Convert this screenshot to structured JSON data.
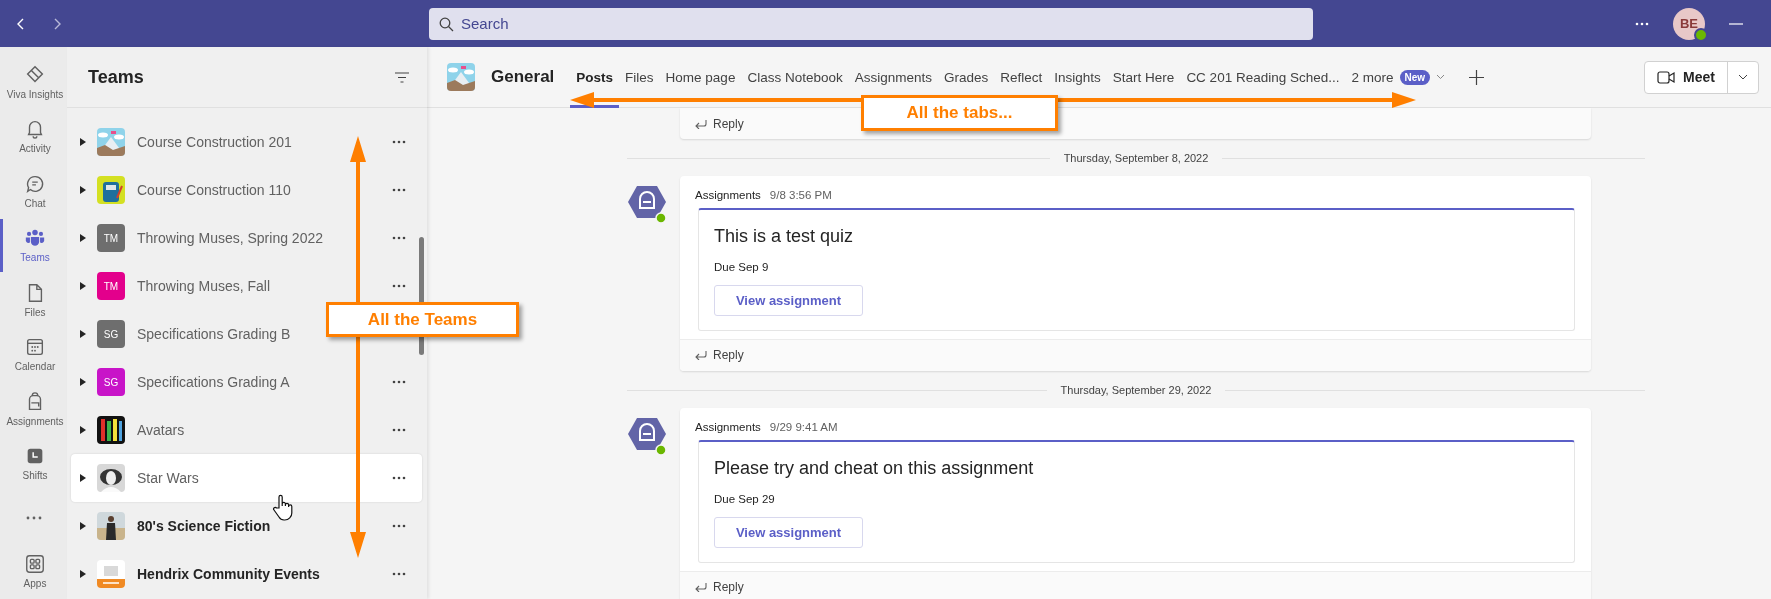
{
  "top_bar": {
    "search": {
      "placeholder": "Search"
    },
    "user": {
      "initials": "BE",
      "online": true
    }
  },
  "rail": [
    {
      "label": "Viva Insights",
      "selected": false
    },
    {
      "label": "Activity",
      "selected": false
    },
    {
      "label": "Chat",
      "selected": false
    },
    {
      "label": "Teams",
      "selected": true
    },
    {
      "label": "Files",
      "selected": false
    },
    {
      "label": "Calendar",
      "selected": false
    },
    {
      "label": "Assignments",
      "selected": false
    },
    {
      "label": "Shifts",
      "selected": false
    },
    {
      "label": "Apps",
      "selected": false
    }
  ],
  "teams_panel": {
    "title": "Teams",
    "teams": [
      {
        "name": "Course Construction 201",
        "unread": false,
        "highlighted": false
      },
      {
        "name": "Course Construction 110",
        "unread": false,
        "highlighted": false
      },
      {
        "name": "Throwing Muses, Spring 2022",
        "avatar": {
          "kind": "initials",
          "initials": "TM",
          "color": "#6e6e6e"
        },
        "unread": false,
        "highlighted": false
      },
      {
        "name": "Throwing Muses, Fall",
        "avatar": {
          "kind": "initials",
          "initials": "TM",
          "color": "#e3008c"
        },
        "unread": false,
        "highlighted": false
      },
      {
        "name": "Specifications Grading B",
        "avatar": {
          "kind": "initials",
          "initials": "SG",
          "color": "#6e6e6e"
        },
        "unread": false,
        "highlighted": false
      },
      {
        "name": "Specifications Grading A",
        "avatar": {
          "kind": "initials",
          "initials": "SG",
          "color": "#c814c8"
        },
        "unread": false,
        "highlighted": false
      },
      {
        "name": "Avatars",
        "unread": false,
        "highlighted": false
      },
      {
        "name": "Star Wars",
        "unread": false,
        "highlighted": true
      },
      {
        "name": "80's Science Fiction",
        "unread": true,
        "highlighted": false
      },
      {
        "name": "Hendrix Community Events",
        "unread": true,
        "highlighted": false
      }
    ]
  },
  "channel": {
    "name": "General",
    "tabs": [
      {
        "label": "Posts",
        "selected": true
      },
      {
        "label": "Files",
        "selected": false
      },
      {
        "label": "Home page",
        "selected": false
      },
      {
        "label": "Class Notebook",
        "selected": false
      },
      {
        "label": "Assignments",
        "selected": false
      },
      {
        "label": "Grades",
        "selected": false
      },
      {
        "label": "Reflect",
        "selected": false
      },
      {
        "label": "Insights",
        "selected": false
      },
      {
        "label": "Start Here",
        "selected": false
      },
      {
        "label": "CC 201 Reading Sched...",
        "selected": false
      }
    ],
    "more_tabs": {
      "label": "2 more",
      "badge": "New"
    },
    "meet_button": "Meet"
  },
  "feed": {
    "top_reply": "Reply",
    "posts": [
      {
        "date": "Thursday, September 8, 2022",
        "sender": "Assignments",
        "time": "9/8 3:56 PM",
        "title": "This is a test quiz",
        "due": "Due Sep 9",
        "button": "View assignment",
        "reply": "Reply"
      },
      {
        "date": "Thursday, September 29, 2022",
        "sender": "Assignments",
        "time": "9/29 9:41 AM",
        "title": "Please try and cheat on this assignment",
        "due": "Due Sep 29",
        "button": "View assignment",
        "reply": "Reply"
      }
    ]
  },
  "annotations": [
    {
      "text": "All the tabs...",
      "kind": "horizontal"
    },
    {
      "text": "All the Teams",
      "kind": "vertical"
    }
  ]
}
